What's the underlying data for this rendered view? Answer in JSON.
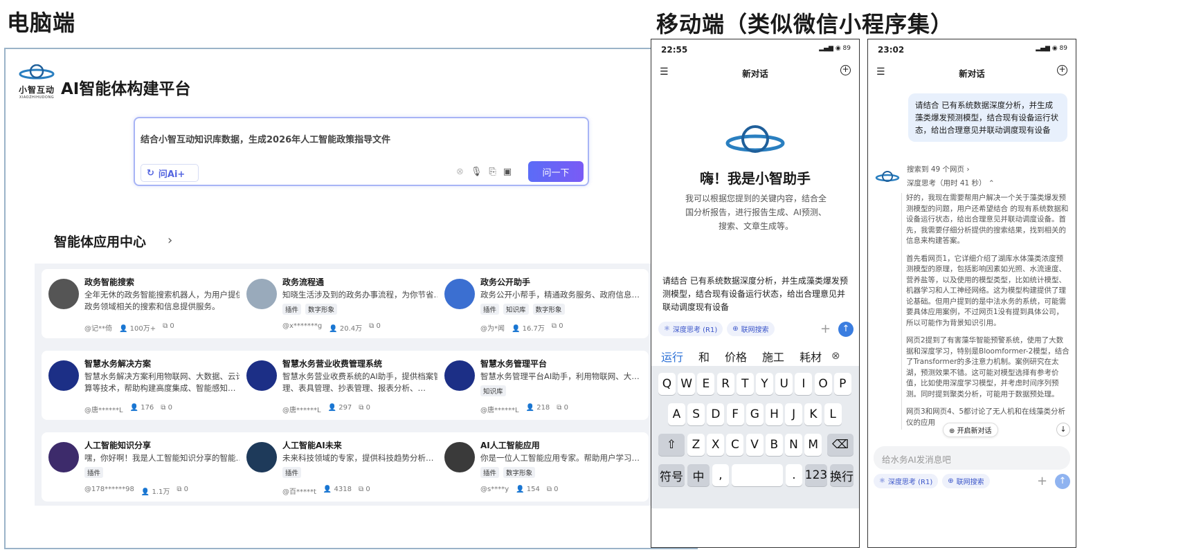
{
  "headers": {
    "desktop": "电脑端",
    "mobile": "移动端（类似微信小程序集）"
  },
  "desktop": {
    "logo_cn": "小智互动",
    "logo_en": "XIAOZHIHUDONG",
    "title": "AI智能体构建平台",
    "search": {
      "query": "结合小智互动知识库数据，生成2026年人工智能政策指导文件",
      "ai_label": "问Ai+",
      "ask_label": "问一下"
    },
    "section_title": "智能体应用中心",
    "cards": [
      {
        "title": "政务智能搜索",
        "desc": "全年无休的政务智能搜索机器人，为用户提供政务领域相关的搜索和信息提供服务。",
        "tags": [],
        "author": "@记**倚",
        "users": "100万+",
        "copies": "0"
      },
      {
        "title": "政务流程通",
        "desc": "知晓生活涉及到的政务办事流程，为你节省时间…",
        "tags": [
          "插件",
          "数字形象"
        ],
        "author": "@x*******g",
        "users": "20.4万",
        "copies": "0"
      },
      {
        "title": "政务公开助手",
        "desc": "政务公开小帮手，精通政务服务、政府信息公开…",
        "tags": [
          "插件",
          "知识库",
          "数字形象"
        ],
        "author": "@为*闻",
        "users": "16.7万",
        "copies": "0"
      },
      {
        "title": "智慧水务解决方案",
        "desc": "智慧水务解决方案利用物联网、大数据、云计算等技术，帮助构建高度集成、智能感知…",
        "tags": [],
        "author": "@唐******L",
        "users": "176",
        "copies": "0"
      },
      {
        "title": "智慧水务营业收费管理系统",
        "desc": "智慧水务营业收费系统的AI助手，提供档案管理、表具管理、抄表管理、报表分析、…",
        "tags": [],
        "author": "@唐******L",
        "users": "297",
        "copies": "0"
      },
      {
        "title": "智慧水务管理平台",
        "desc": "智慧水务管理平台AI助手，利用物联网、大数据…",
        "tags": [
          "知识库"
        ],
        "author": "@唐******L",
        "users": "218",
        "copies": "0"
      },
      {
        "title": "人工智能知识分享",
        "desc": "嘿，你好啊！我是人工智能知识分享的智能体…",
        "tags": [
          "插件"
        ],
        "author": "@178******98",
        "users": "1.1万",
        "copies": "0"
      },
      {
        "title": "人工智能AI未来",
        "desc": "未来科技领域的专家，提供科技趋势分析…",
        "tags": [
          "插件"
        ],
        "author": "@百*****t",
        "users": "4318",
        "copies": "0"
      },
      {
        "title": "AI人工智能应用",
        "desc": "你是一位人工智能应用专家。帮助用户学习…",
        "tags": [
          "插件",
          "数字形象"
        ],
        "author": "@s****y",
        "users": "154",
        "copies": "0"
      }
    ]
  },
  "phone1": {
    "time": "22:55",
    "battery": "89",
    "nav_title": "新对话",
    "greeting": "嗨！我是小智助手",
    "intro": "我可以根据您提到的关键内容，结合全国分析报告，进行报告生成、AI预测、搜索、文章生成等。",
    "input": "请结合        已有系统数据深度分析，并生成藻类爆发预测模型，结合现有设备运行状态，给出合理意见并联动调度现有设备",
    "chip_deep": "深度思考 (R1)",
    "chip_web": "联网搜索",
    "suggestions": [
      "运行",
      "和",
      "价格",
      "施工",
      "耗材"
    ],
    "keys_row1": [
      "Q",
      "W",
      "E",
      "R",
      "T",
      "Y",
      "U",
      "I",
      "O",
      "P"
    ],
    "keys_row2": [
      "A",
      "S",
      "D",
      "F",
      "G",
      "H",
      "J",
      "K",
      "L"
    ],
    "keys_row3": [
      "Z",
      "X",
      "C",
      "V",
      "B",
      "N",
      "M"
    ],
    "key_symbols": "符号",
    "key_zh": "中",
    "key_num": "123",
    "key_enter": "换行"
  },
  "phone2": {
    "time": "23:02",
    "battery": "89",
    "nav_title": "新对话",
    "user_msg": "请结合        已有系统数据深度分析，并生成藻类爆发预测模型，结合现有设备运行状态，给出合理意见并联动调度现有设备",
    "search_count": "搜索到 49 个网页",
    "think_time": "深度思考（用时 41 秒）",
    "paragraphs": [
      "好的，我现在需要帮用户解决一个关于藻类爆发预测模型的问题，用户还希望结合        的现有系统数据和设备运行状态，给出合理意见并联动调度设备。首先，我需要仔细分析提供的搜索结果，找到相关的信息来构建答案。",
      "首先看网页1，它详细介绍了湖库水体藻类浓度预测模型的原理，包括影响因素如光照、水流速度、营养盐等，以及使用的模型类型，比如统计模型、机器学习和人工神经网络。这为模型构建提供了理论基础。但用户提到的是中法水务的系统，可能需要具体应用案例，不过网页1没有提到具体公司，所以可能作为背景知识引用。",
      "网页2提到了有害藻华智能预警系统，使用了大数据和深度学习，特别是Bloomformer-2模型，结合了Transformer的多注意力机制。案例研究在太湖，预测效果不错。这可能对模型选择有参考价值，比如使用深度学习模型，并考虑时间序列预测。同时提到聚类分析，可能用于数据预处理。",
      "网页3和网页4、5都讨论了无人机和在线藻类分析仪的应用"
    ],
    "new_chat": "开启新对话",
    "input_placeholder": "给水务AI发消息吧",
    "chip_deep": "深度思考 (R1)",
    "chip_web": "联网搜索"
  }
}
